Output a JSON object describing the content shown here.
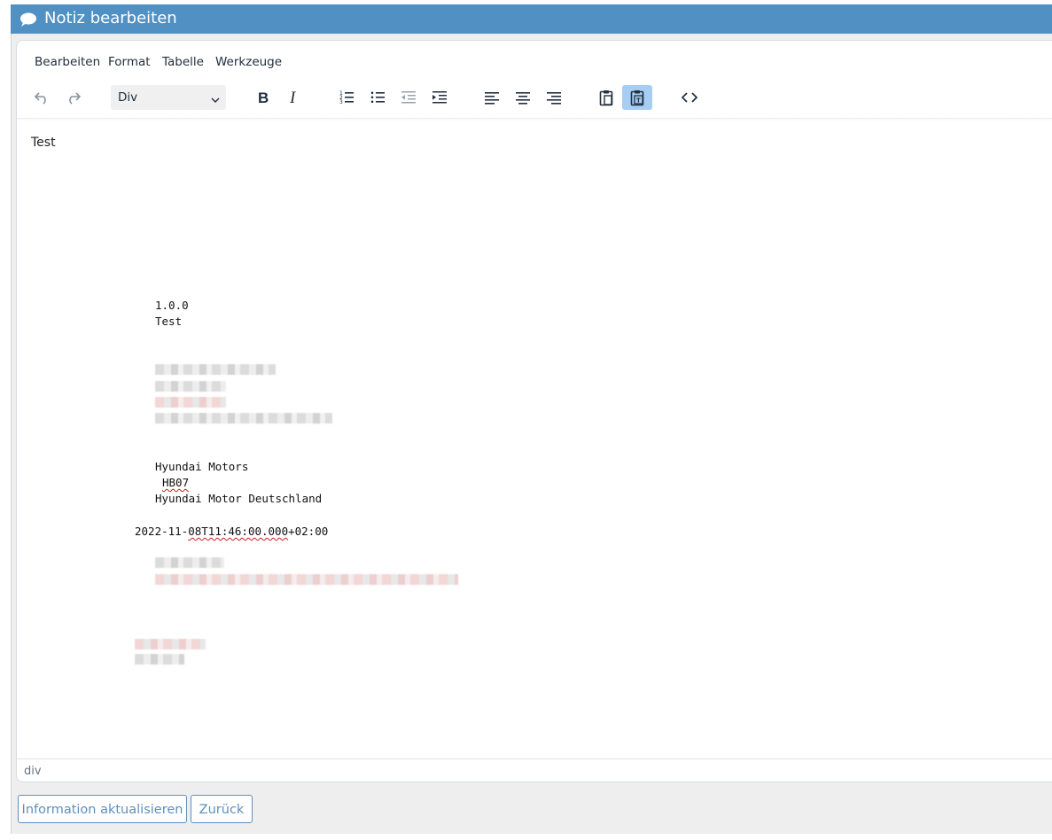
{
  "dialog": {
    "title": "Notiz bearbeiten",
    "icon": "speech-bubble-icon"
  },
  "menu": {
    "items": [
      "Bearbeiten",
      "Format",
      "Tabelle",
      "Werkzeuge"
    ]
  },
  "toolbar": {
    "block_format_value": "Div",
    "buttons": [
      "undo-icon",
      "redo-icon",
      "bold-icon",
      "italic-icon",
      "ordered-list-icon",
      "bullet-list-icon",
      "outdent-icon",
      "indent-icon",
      "align-left-icon",
      "align-center-icon",
      "align-right-icon",
      "paste-icon",
      "paste-as-text-icon",
      "source-code-icon"
    ]
  },
  "content": {
    "first_line": "Test",
    "version": "1.0.0",
    "version_label": "Test",
    "company": "Hyundai Motors",
    "code": "HB07",
    "division": "Hyundai Motor Deutschland",
    "timestamp_prefix": "2022-11-",
    "timestamp_misspelled": "08T11:46:00.000",
    "timestamp_suffix": "+02:00"
  },
  "statusbar": {
    "element_path": "div"
  },
  "actions": {
    "update_label": "Information aktualisieren",
    "back_label": "Zurück"
  },
  "colors": {
    "titlebar": "#5190c3",
    "button_text": "#5f8fbd",
    "active_tool": "#a7cdf3"
  }
}
